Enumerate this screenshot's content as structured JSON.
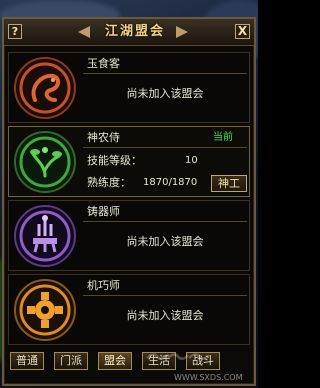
{
  "window": {
    "title": "江湖盟会",
    "help_label": "?",
    "close_label": "X"
  },
  "guilds": [
    {
      "name": "玉食客",
      "status": "尚未加入该盟会",
      "emblem_icon": "fish-dragon-emblem-icon",
      "emblem_color": "#c8502a"
    },
    {
      "name": "神农侍",
      "current_tag": "当前",
      "skill_level_label": "技能等级：",
      "skill_level_value": "10",
      "proficiency_label": "熟练度：",
      "proficiency_value": "1870/1870",
      "shengong_label": "神工",
      "emblem_icon": "herb-emblem-icon",
      "emblem_color": "#3fa83a"
    },
    {
      "name": "铸器师",
      "status": "尚未加入该盟会",
      "emblem_icon": "anvil-emblem-icon",
      "emblem_color": "#8e5cc8"
    },
    {
      "name": "机巧师",
      "status": "尚未加入该盟会",
      "emblem_icon": "gear-emblem-icon",
      "emblem_color": "#e08a24"
    }
  ],
  "tabs": [
    {
      "label": "普通"
    },
    {
      "label": "门派"
    },
    {
      "label": "盟会"
    },
    {
      "label": "生活"
    },
    {
      "label": "战斗"
    }
  ],
  "watermark": {
    "url": "WWW.SXDS.COM"
  }
}
